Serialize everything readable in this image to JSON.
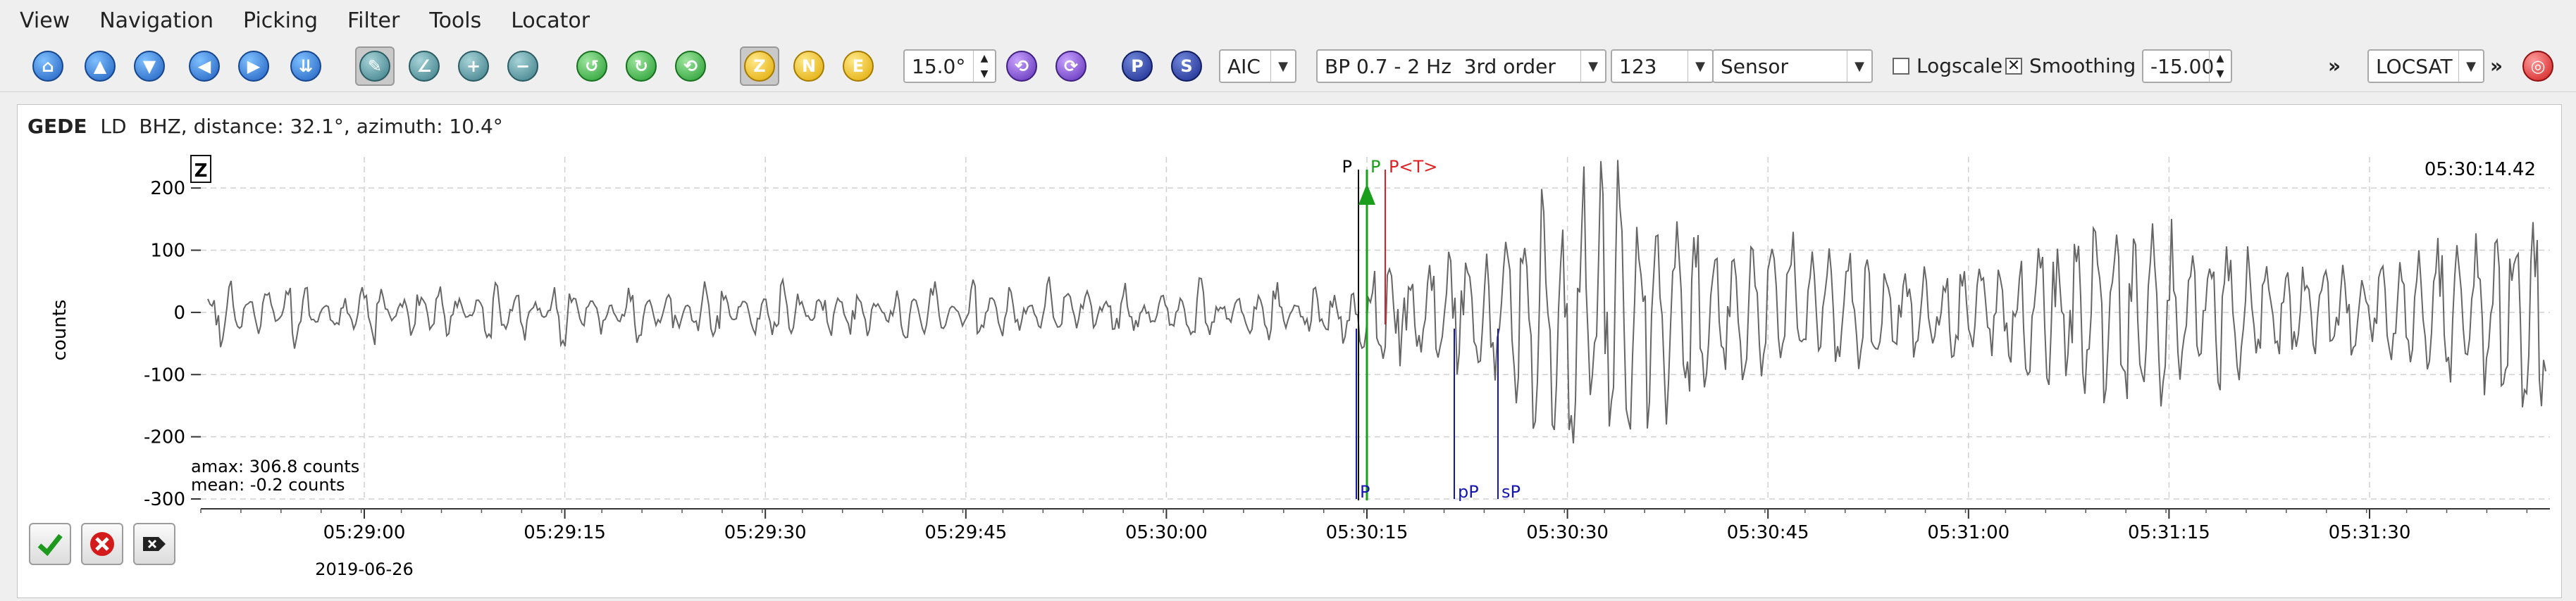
{
  "menubar": {
    "items": [
      "View",
      "Navigation",
      "Picking",
      "Filter",
      "Tools",
      "Locator"
    ]
  },
  "toolbar": {
    "component_buttons": [
      "Z",
      "N",
      "E"
    ],
    "phase_buttons": [
      "P",
      "S"
    ],
    "rotation_value": "15.0°",
    "picker_method": "AIC",
    "filter": "BP 0.7 - 2 Hz  3rd order",
    "filter_order": "123",
    "units": "Sensor",
    "logscale_label": "Logscale",
    "logscale_checked": false,
    "smoothing_label": "Smoothing",
    "smoothing_checked": true,
    "smoothing_value": "-15.00",
    "overflow_glyph": "»",
    "locator": "LOCSAT",
    "locator_overflow": "»",
    "icons": [
      "home-icon",
      "scroll-up-icon",
      "scroll-down-icon",
      "previous-icon",
      "next-icon",
      "align-icon",
      "pick-tool-icon",
      "angle-tool-icon",
      "zoom-in-icon",
      "zoom-out-icon",
      "pick-p-icon",
      "pick-s-icon",
      "pick-other-icon",
      "rotate-left-icon",
      "rotate-right-icon",
      "target-icon"
    ]
  },
  "trace": {
    "station": "GEDE",
    "details": "LD  BHZ, distance: 32.1°, azimuth: 10.4°",
    "component_label": "Z",
    "time_label": "05:30:14.42",
    "y_axis_label": "counts",
    "y_ticks": [
      "200",
      "100",
      "0",
      "-100",
      "-200",
      "-300"
    ],
    "x_ticks": [
      "05:29:00",
      "05:29:15",
      "05:29:30",
      "05:29:45",
      "05:30:00",
      "05:30:15",
      "05:30:30",
      "05:30:45",
      "05:31:00",
      "05:31:15",
      "05:31:30"
    ],
    "date_label": "2019-06-26",
    "amax_label": "amax: 306.8 counts",
    "mean_label": "mean: -0.2 counts",
    "picks": {
      "black": "P",
      "green": "P",
      "red": "P<T>"
    },
    "theoretical": [
      "P",
      "pP",
      "sP"
    ]
  },
  "colors": {
    "trace": "#666666",
    "grid": "#d0d0d0",
    "pick_green": "#1b9e1b",
    "pick_red": "#e02020",
    "theo_blue": "#1515b0"
  },
  "chart_data": {
    "type": "line",
    "title": "",
    "xlabel": "",
    "ylabel": "counts",
    "x_ticks": [
      "05:29:00",
      "05:29:15",
      "05:29:30",
      "05:29:45",
      "05:30:00",
      "05:30:15",
      "05:30:30",
      "05:30:45",
      "05:31:00",
      "05:31:15",
      "05:31:30"
    ],
    "ylim": [
      -300,
      250
    ],
    "grid": true,
    "series": [
      {
        "values": [
          0
        ]
      }
    ]
  }
}
